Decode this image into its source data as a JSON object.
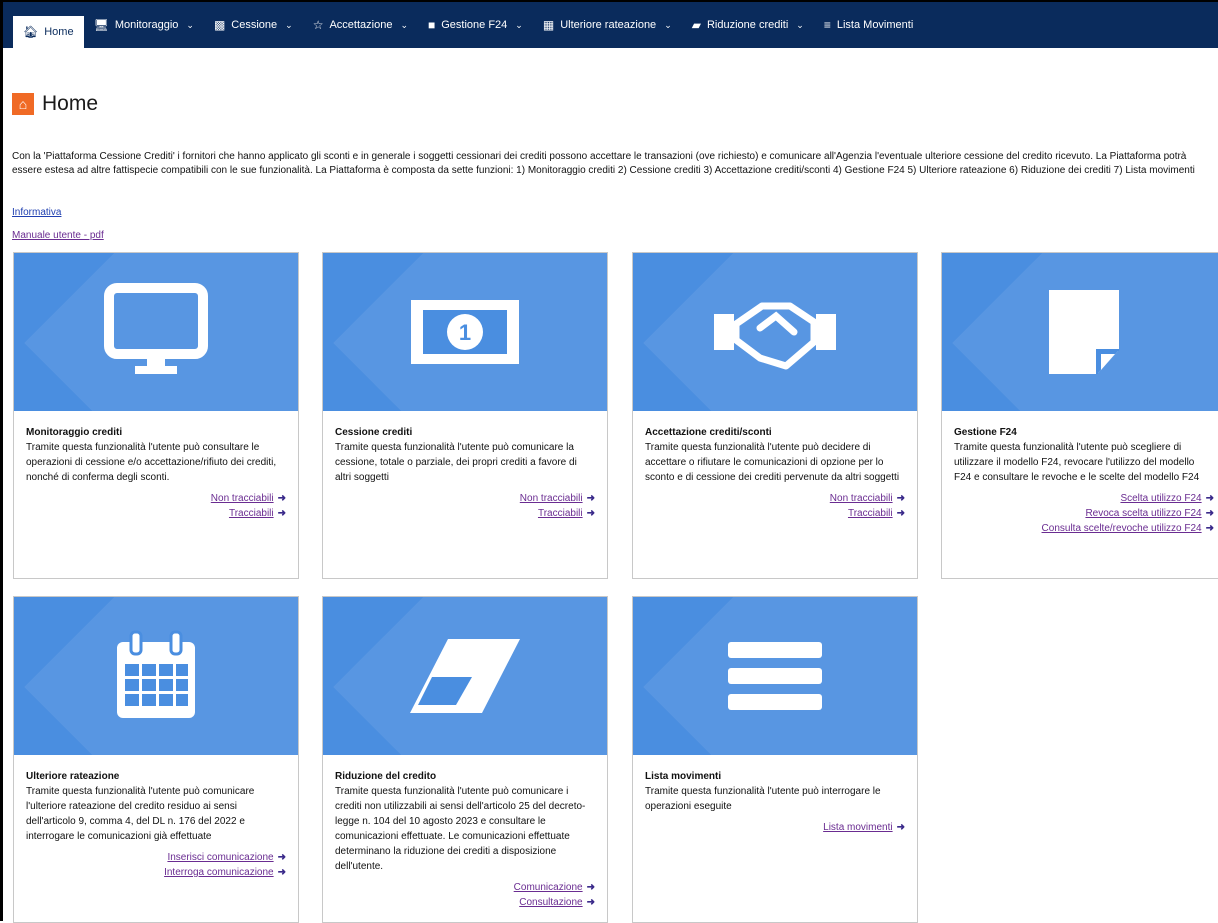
{
  "nav": [
    {
      "label": "Home",
      "icon": "home-icon",
      "active": true
    },
    {
      "label": "Monitoraggio",
      "icon": "monitor-icon"
    },
    {
      "label": "Cessione",
      "icon": "banknote-icon"
    },
    {
      "label": "Accettazione",
      "icon": "handshake-icon"
    },
    {
      "label": "Gestione F24",
      "icon": "document-icon"
    },
    {
      "label": "Ulteriore rateazione",
      "icon": "calendar-icon"
    },
    {
      "label": "Riduzione crediti",
      "icon": "eraser-icon"
    },
    {
      "label": "Lista Movimenti",
      "icon": "list-icon"
    }
  ],
  "page": {
    "title": "Home",
    "intro": "Con la 'Piattaforma Cessione Crediti' i fornitori che hanno applicato gli sconti e in generale i soggetti cessionari dei crediti possono accettare le transazioni (ove richiesto) e comunicare all'Agenzia l'eventuale ulteriore cessione del credito ricevuto. La Piattaforma potrà essere estesa ad altre fattispecie compatibili con le sue funzionalità. La Piattaforma è composta da sette funzioni: 1) Monitoraggio crediti 2) Cessione crediti 3) Accettazione crediti/sconti 4) Gestione F24 5) Ulteriore rateazione 6) Riduzione dei crediti 7) Lista movimenti",
    "link_informativa": "Informativa",
    "link_manuale": "Manuale utente - pdf"
  },
  "cards": [
    {
      "title": "Monitoraggio crediti",
      "desc": "Tramite questa funzionalità l'utente può consultare le operazioni di cessione e/o accettazione/rifiuto dei crediti, nonché di conferma degli sconti.",
      "icon": "monitor-icon",
      "links": [
        "Non tracciabili",
        "Tracciabili"
      ]
    },
    {
      "title": "Cessione crediti",
      "desc": "Tramite questa funzionalità l'utente può comunicare la cessione, totale o parziale, dei propri crediti a favore di altri soggetti",
      "icon": "banknote-icon",
      "links": [
        "Non tracciabili",
        "Tracciabili"
      ]
    },
    {
      "title": "Accettazione crediti/sconti",
      "desc": "Tramite questa funzionalità l'utente può decidere di accettare o rifiutare le comunicazioni di opzione per lo sconto e di cessione dei crediti pervenute da altri soggetti",
      "icon": "handshake-icon",
      "links": [
        "Non tracciabili",
        "Tracciabili"
      ]
    },
    {
      "title": "Gestione F24",
      "desc": "Tramite questa funzionalità l'utente può scegliere di utilizzare il modello F24, revocare l'utilizzo del modello F24 e consultare le revoche e le scelte del modello F24",
      "icon": "document-icon",
      "links": [
        "Scelta utilizzo F24",
        "Revoca scelta utilizzo F24",
        "Consulta scelte/revoche utilizzo F24"
      ]
    },
    {
      "title": "Ulteriore rateazione",
      "desc": "Tramite questa funzionalità l'utente può comunicare l'ulteriore rateazione del credito residuo ai sensi dell'articolo 9, comma 4, del DL n. 176 del 2022 e interrogare le comunicazioni già effettuate",
      "icon": "calendar-icon",
      "links": [
        "Inserisci comunicazione",
        "Interroga comunicazione"
      ]
    },
    {
      "title": "Riduzione del credito",
      "desc": "Tramite questa funzionalità l'utente può comunicare i crediti non utilizzabili ai sensi dell'articolo 25 del decreto-legge n. 104 del 10 agosto 2023 e consultare le comunicazioni effettuate. Le comunicazioni effettuate determinano la riduzione dei crediti a disposizione dell'utente.",
      "icon": "eraser-icon",
      "links": [
        "Comunicazione",
        "Consultazione"
      ]
    },
    {
      "title": "Lista movimenti",
      "desc": "Tramite questa funzionalità l'utente può interrogare le operazioni eseguite",
      "icon": "list-icon",
      "links": [
        "Lista movimenti"
      ]
    }
  ],
  "colors": {
    "navbar": "#0a2b5c",
    "card_blue": "#4a8ee0",
    "home_badge": "#f06a25",
    "link": "#6a2c91"
  }
}
